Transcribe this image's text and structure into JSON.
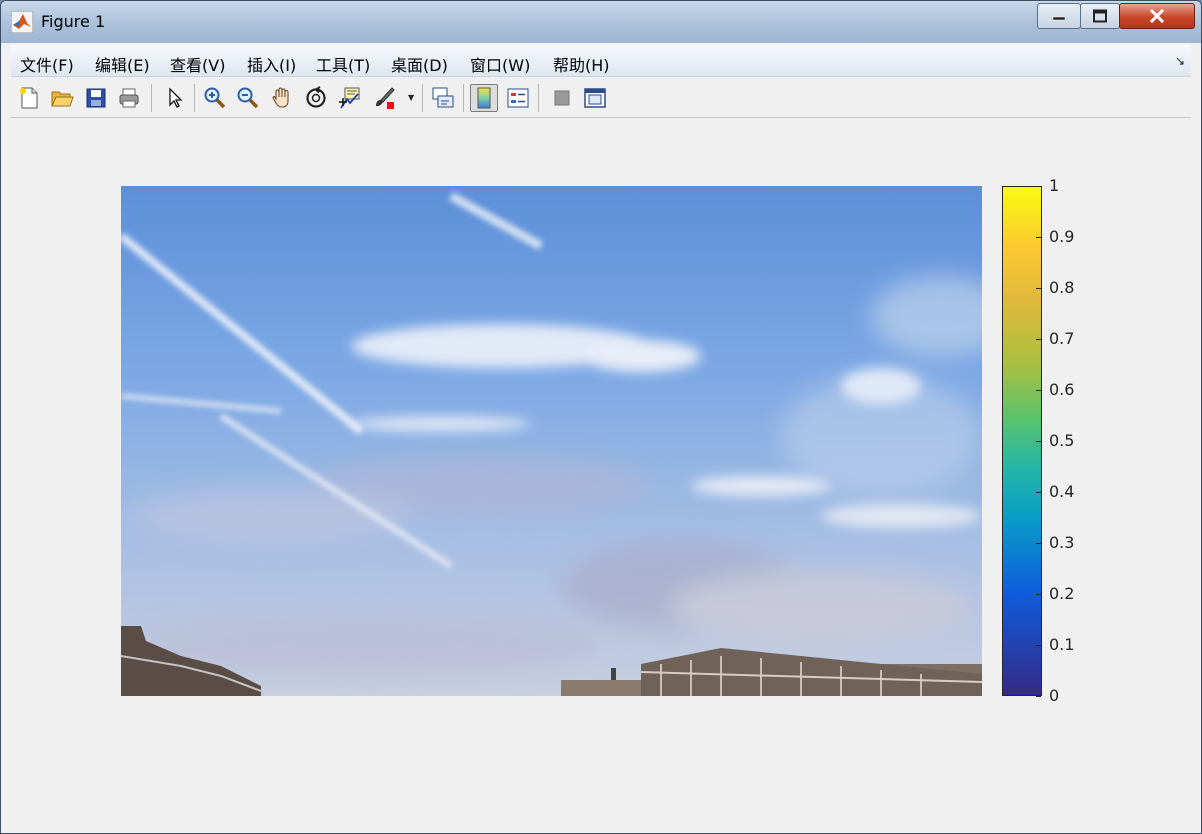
{
  "window": {
    "title": "Figure 1"
  },
  "menubar": {
    "items": [
      {
        "label": "文件(F)"
      },
      {
        "label": "编辑(E)"
      },
      {
        "label": "查看(V)"
      },
      {
        "label": "插入(I)"
      },
      {
        "label": "工具(T)"
      },
      {
        "label": "桌面(D)"
      },
      {
        "label": "窗口(W)"
      },
      {
        "label": "帮助(H)"
      }
    ]
  },
  "toolbar": {
    "buttons": [
      {
        "icon": "new-figure-icon"
      },
      {
        "icon": "open-folder-icon"
      },
      {
        "icon": "save-icon"
      },
      {
        "icon": "print-icon"
      },
      {
        "icon": "pointer-icon"
      },
      {
        "icon": "zoom-in-icon"
      },
      {
        "icon": "zoom-out-icon"
      },
      {
        "icon": "pan-hand-icon"
      },
      {
        "icon": "rotate-3d-icon"
      },
      {
        "icon": "data-cursor-icon"
      },
      {
        "icon": "brush-icon"
      },
      {
        "icon": "link-plot-icon"
      },
      {
        "icon": "colorbar-icon"
      },
      {
        "icon": "legend-icon"
      },
      {
        "icon": "hide-plot-tools-icon"
      },
      {
        "icon": "show-plot-tools-icon"
      }
    ]
  },
  "colorbar": {
    "ticks": [
      "1",
      "0.9",
      "0.8",
      "0.7",
      "0.6",
      "0.5",
      "0.4",
      "0.3",
      "0.2",
      "0.1",
      "0"
    ],
    "colors": [
      "#352a87",
      "#0f5cdd",
      "#0a9ec7",
      "#24b6a3",
      "#5ec36a",
      "#a9bf40",
      "#e1b93a",
      "#fbc831",
      "#f9fb0e"
    ]
  },
  "image": {
    "subject": "sky-with-clouds-photo"
  }
}
